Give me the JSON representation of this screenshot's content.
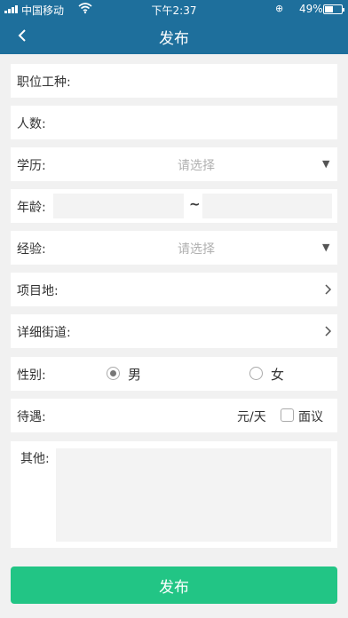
{
  "status_bar": {
    "carrier": "中国移动",
    "time": "下午2:37",
    "battery": "49%",
    "battery_level": 0.49
  },
  "navbar": {
    "title": "发布"
  },
  "form": {
    "position_label": "职位工种:",
    "headcount_label": "人数:",
    "education_label": "学历:",
    "education_placeholder": "请选择",
    "age_label": "年龄:",
    "age_separator": "~",
    "experience_label": "经验:",
    "experience_placeholder": "请选择",
    "project_location_label": "项目地:",
    "street_label": "详细街道:",
    "gender_label": "性别:",
    "gender_options": [
      "男",
      "女"
    ],
    "gender_selected": "男",
    "salary_label": "待遇:",
    "salary_unit": "元/天",
    "negotiable_label": "面议",
    "other_label": "其他:"
  },
  "submit_label": "发布"
}
